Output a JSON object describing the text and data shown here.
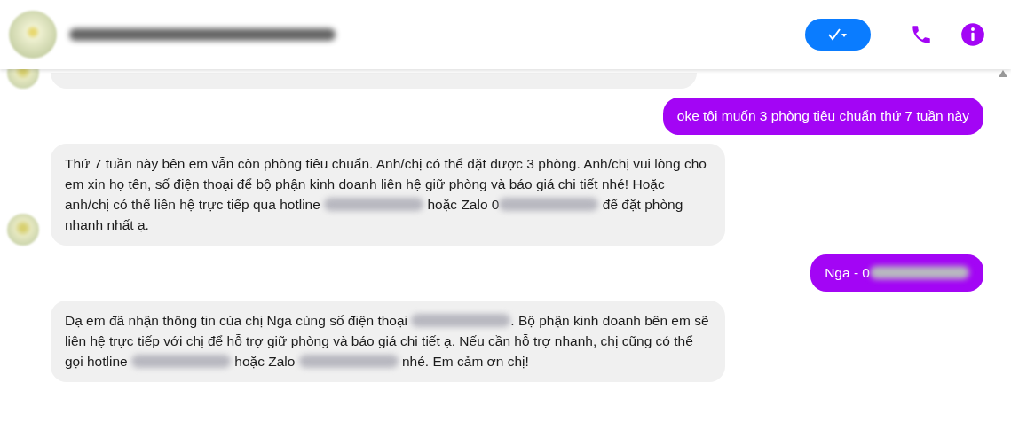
{
  "header": {
    "name": [
      {
        "kind": "redacted"
      }
    ]
  },
  "messages": [
    {
      "kind": "incoming_clipped",
      "show_avatar": true
    },
    {
      "kind": "outgoing",
      "parts": [
        {
          "kind": "text",
          "text": "oke tôi muốn 3 phòng tiêu chuẩn thứ 7 tuần này"
        }
      ]
    },
    {
      "kind": "incoming",
      "show_avatar": true,
      "parts": [
        {
          "kind": "text",
          "text": "Thứ 7 tuần này bên em vẫn còn phòng tiêu chuẩn. Anh/chị có thể đặt được 3 phòng. Anh/chị vui lòng cho em xin họ tên, số điện thoại để bộ phận kinh doanh liên hệ giữ phòng và báo giá chi tiết nhé! Hoặc anh/chị có thể liên hệ trực tiếp qua hotline "
        },
        {
          "kind": "redacted"
        },
        {
          "kind": "text",
          "text": " hoặc Zalo 0"
        },
        {
          "kind": "redacted"
        },
        {
          "kind": "text",
          "text": " để đặt phòng nhanh nhất ạ."
        }
      ]
    },
    {
      "kind": "outgoing",
      "parts": [
        {
          "kind": "text",
          "text": "Nga - 0"
        },
        {
          "kind": "redacted"
        }
      ]
    },
    {
      "kind": "incoming",
      "show_avatar": false,
      "parts": [
        {
          "kind": "text",
          "text": "Dạ em đã nhận thông tin của chị Nga cùng số điện thoại "
        },
        {
          "kind": "redacted"
        },
        {
          "kind": "text",
          "text": ". Bộ phận kinh doanh bên em sẽ liên hệ trực tiếp với chị để hỗ trợ giữ phòng và báo giá chi tiết ạ. Nếu cần hỗ trợ nhanh, chị cũng có thể gọi hotline "
        },
        {
          "kind": "redacted"
        },
        {
          "kind": "text",
          "text": " hoặc Zalo "
        },
        {
          "kind": "redacted"
        },
        {
          "kind": "text",
          "text": " nhé. Em cảm ơn chị!"
        }
      ]
    }
  ]
}
